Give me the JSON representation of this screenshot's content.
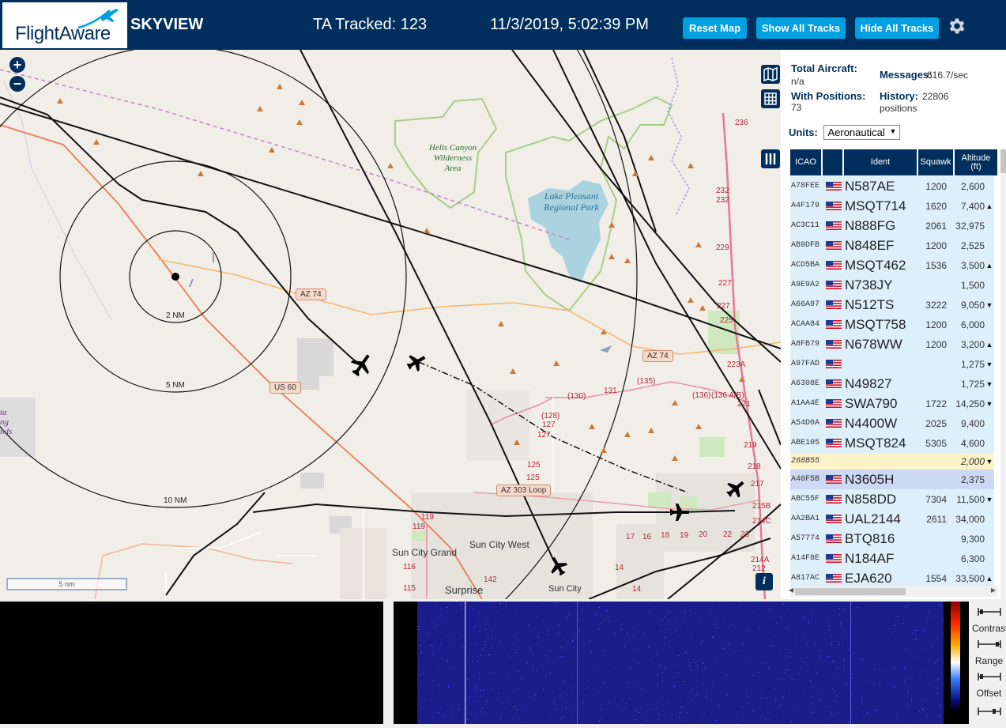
{
  "header": {
    "logo_text": "FlightAware",
    "app_title": "SKYVIEW",
    "ta_tracked": "TA Tracked: 123",
    "datetime": "11/3/2019, 5:02:39 PM",
    "buttons": {
      "reset_map": "Reset Map",
      "show_all": "Show All Tracks",
      "hide_all": "Hide All Tracks"
    },
    "settings_icon": "gear-icon",
    "accent_color": "#00a0e2",
    "bar_color": "#002f5d"
  },
  "map": {
    "zoom_in": "+",
    "zoom_out": "−",
    "scale_label": "5 nm",
    "info_label": "i",
    "range_rings": [
      "2 NM",
      "5 NM",
      "10 NM"
    ],
    "routes": [
      "AZ 74",
      "AZ 74",
      "US 60",
      "AZ 303 Loop"
    ],
    "parks": [
      "Hells Canyon Wilderness Area",
      "Lake Pleasant Regional Park"
    ],
    "cities": [
      "Sun City Grand",
      "Sun City West",
      "Surprise",
      "Sun City"
    ],
    "road_numbers": [
      "236",
      "232",
      "232",
      "229",
      "227",
      "227",
      "225",
      "223A",
      "221",
      "(136)",
      "(136 A/B)",
      "(135)",
      "(130)",
      "131",
      "(128)",
      "127",
      "127",
      "125",
      "125",
      "218",
      "219",
      "217",
      "215B",
      "214C",
      "214A",
      "212",
      "119",
      "119",
      "116",
      "115",
      "142",
      "14",
      "14",
      "17",
      "16",
      "18",
      "19",
      "20",
      "22",
      "23"
    ],
    "edge_text": [
      "ta",
      "ng",
      "nds"
    ]
  },
  "panel": {
    "total_aircraft_label": "Total Aircraft:",
    "total_aircraft_value": "n/a",
    "with_positions_label": "With Positions:",
    "with_positions_value": "73",
    "messages_label": "Messages:",
    "messages_value": "616.7/sec",
    "history_label": "History:",
    "history_value": "22806",
    "history_unit": "positions",
    "units_label": "Units:",
    "units_value": "Aeronautical",
    "columns": [
      "ICAO",
      "Ident",
      "Squawk",
      "Altitude (ft)"
    ],
    "rows": [
      {
        "icao": "A78FEE",
        "ident": "N587AE",
        "squawk": "1200",
        "alt": "2,600",
        "trend": ""
      },
      {
        "icao": "A4F179",
        "ident": "MSQT714",
        "squawk": "1620",
        "alt": "7,400",
        "trend": "▲"
      },
      {
        "icao": "AC3C11",
        "ident": "N888FG",
        "squawk": "2061",
        "alt": "32,975",
        "trend": ""
      },
      {
        "icao": "AB9DFB",
        "ident": "N848EF",
        "squawk": "1200",
        "alt": "2,525",
        "trend": ""
      },
      {
        "icao": "ACD5BA",
        "ident": "MSQT462",
        "squawk": "1536",
        "alt": "3,500",
        "trend": "▲"
      },
      {
        "icao": "A9E9A2",
        "ident": "N738JY",
        "squawk": "",
        "alt": "1,500",
        "trend": ""
      },
      {
        "icao": "A66A97",
        "ident": "N512TS",
        "squawk": "3222",
        "alt": "9,050",
        "trend": "▼"
      },
      {
        "icao": "ACAA84",
        "ident": "MSQT758",
        "squawk": "1200",
        "alt": "6,000",
        "trend": ""
      },
      {
        "icao": "A8FB79",
        "ident": "N678WW",
        "squawk": "1200",
        "alt": "3,200",
        "trend": "▲"
      },
      {
        "icao": "A97FAD",
        "ident": "",
        "squawk": "",
        "alt": "1,275",
        "trend": "▼"
      },
      {
        "icao": "A6308E",
        "ident": "N49827",
        "squawk": "",
        "alt": "1,725",
        "trend": "▼"
      },
      {
        "icao": "A1AA4E",
        "ident": "SWA790",
        "squawk": "1722",
        "alt": "14,250",
        "trend": "▼"
      },
      {
        "icao": "A54D0A",
        "ident": "N4400W",
        "squawk": "2025",
        "alt": "9,400",
        "trend": ""
      },
      {
        "icao": "ABE105",
        "ident": "MSQT824",
        "squawk": "5305",
        "alt": "4,600",
        "trend": ""
      },
      {
        "icao": "268B55",
        "ident": "",
        "squawk": "",
        "alt": "2,000",
        "trend": "▼",
        "style": "yellow"
      },
      {
        "icao": "A40F5B",
        "ident": "N3605H",
        "squawk": "",
        "alt": "2,375",
        "trend": "",
        "style": "blue"
      },
      {
        "icao": "ABC55F",
        "ident": "N858DD",
        "squawk": "7304",
        "alt": "11,500",
        "trend": "▼"
      },
      {
        "icao": "AA2BA1",
        "ident": "UAL2144",
        "squawk": "2611",
        "alt": "34,000",
        "trend": ""
      },
      {
        "icao": "A57774",
        "ident": "BTQ816",
        "squawk": "",
        "alt": "9,300",
        "trend": ""
      },
      {
        "icao": "A14F8E",
        "ident": "N184AF",
        "squawk": "",
        "alt": "6,300",
        "trend": ""
      },
      {
        "icao": "A817AC",
        "ident": "EJA620",
        "squawk": "1554",
        "alt": "33,500",
        "trend": "▲"
      }
    ]
  },
  "sdr": {
    "contrast_label": "Contrast",
    "range_label": "Range",
    "offset_label": "Offset"
  }
}
